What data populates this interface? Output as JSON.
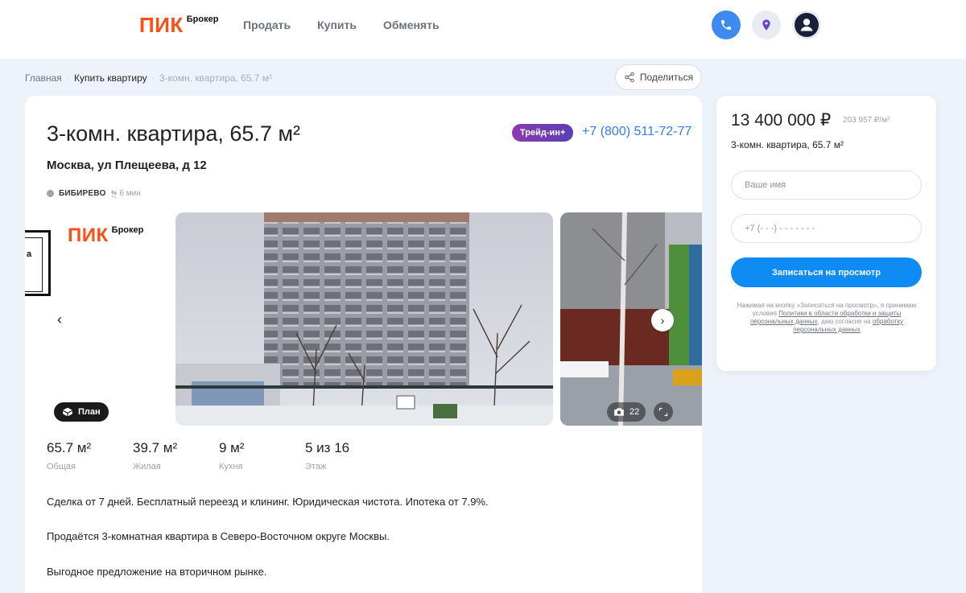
{
  "header": {
    "logo_main": "ПИК",
    "logo_sub": "Брокер",
    "nav": [
      "Продать",
      "Купить",
      "Обменять"
    ]
  },
  "breadcrumbs": {
    "items": [
      "Главная",
      "Купить квартиру",
      "3-комн. квартира, 65.7 м²"
    ],
    "separator": "·",
    "share_label": "Поделиться"
  },
  "listing": {
    "title": "3-комн. квартира, 65.7 м²",
    "badge": "Трейд-ин+",
    "phone": "+7 (800) 511-72-77",
    "address": "Москва, ул Плещеева, д 12",
    "metro": {
      "name": "БИБИРЕВО",
      "walk": "6 мин"
    },
    "gallery": {
      "plan_logo_main": "ПИК",
      "plan_logo_sub": "Брокер",
      "plan_letter": "a",
      "plan_label": "План",
      "photo_count": "22"
    },
    "specs": [
      {
        "value": "65.7 м²",
        "label": "Общая"
      },
      {
        "value": "39.7 м²",
        "label": "Жилая"
      },
      {
        "value": "9 м²",
        "label": "Кухня"
      },
      {
        "value": "5 из 16",
        "label": "Этаж"
      }
    ],
    "description": [
      "Сделка от 7 дней. Бесплатный переезд и клининг. Юридическая чистота. Ипотека от 7.9%.",
      "Продаётся 3-комнатная квартира в Северо-Восточном округе Москвы.",
      "Выгодное предложение на вторичном рынке."
    ]
  },
  "sidebar": {
    "price": "13 400 000 ₽",
    "price_per_m": "203 957 ₽/м²",
    "subtitle": "3-комн. квартира, 65.7 м²",
    "name_placeholder": "Ваше имя",
    "phone_placeholder": "+7 (- - -) - - - - - - -",
    "submit_label": "Записаться на просмотр",
    "legal_before": "Нажимая на кнопку «Записаться на просмотр», я принимаю условия ",
    "legal_link1": "Политики в области обработки и защиты персональных данных",
    "legal_middle": ", даю согласие на ",
    "legal_link2": "обработку персональных данных"
  },
  "colors": {
    "brand": "#ff4f12",
    "accent_blue": "#0f8cf3",
    "badge_purple": "#7b3cb3"
  }
}
